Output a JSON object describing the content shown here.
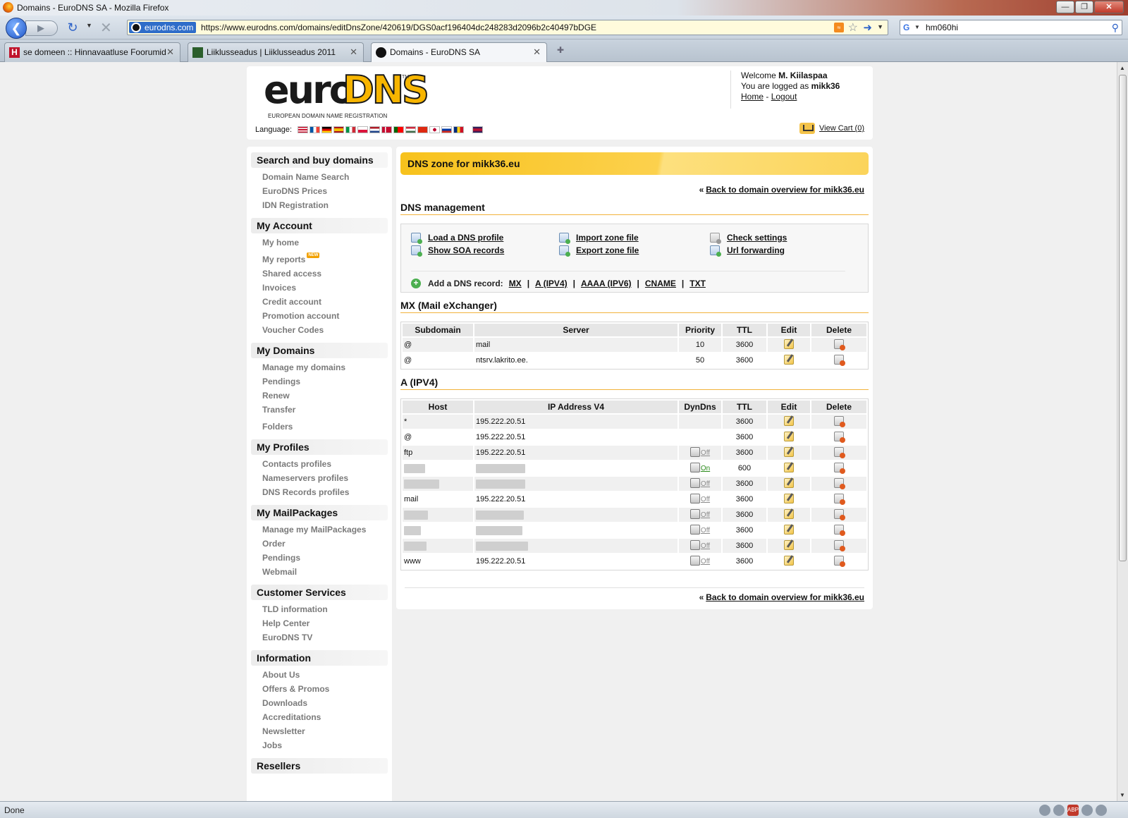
{
  "window": {
    "title": "Domains - EuroDNS SA - Mozilla Firefox"
  },
  "toolbar": {
    "site_identity": "eurodns.com",
    "url": "https://www.eurodns.com/domains/editDnsZone/420619/DGS0acf196404dc248283d2096b2c40497bDGE",
    "search_value": "hm060hi"
  },
  "tabs": [
    {
      "label": "se domeen :: Hinnavaatluse Foorumid"
    },
    {
      "label": "Liiklusseadus | Liiklusseadus 2011"
    },
    {
      "label": "Domains - EuroDNS SA"
    }
  ],
  "status": {
    "text": "Done"
  },
  "header": {
    "logo_euro": "euro",
    "logo_dns": "DNS",
    "tagline": "EUROPEAN DOMAIN NAME REGISTRATION",
    "welcome_prefix": "Welcome",
    "welcome_name": "M. Kiilaspaa",
    "logged_prefix": "You are logged as",
    "logged_user": "mikk36",
    "home_link": "Home",
    "separator": "-",
    "logout_link": "Logout",
    "language_label": "Language:",
    "cart_link": "View Cart (0)"
  },
  "sidebar": {
    "sections": [
      {
        "title": "Search and buy domains",
        "items": [
          "Domain Name Search",
          "EuroDNS Prices",
          "IDN Registration"
        ]
      },
      {
        "title": "My Account",
        "items": [
          "My home",
          "My reports",
          "Shared access",
          "Invoices",
          "Credit account",
          "Promotion account",
          "Voucher Codes"
        ]
      },
      {
        "title": "My Domains",
        "items": [
          "Manage my domains",
          "Pendings",
          "Renew",
          "Transfer",
          "Folders"
        ]
      },
      {
        "title": "My Profiles",
        "items": [
          "Contacts profiles",
          "Nameservers profiles",
          "DNS Records profiles"
        ]
      },
      {
        "title": "My MailPackages",
        "items": [
          "Manage my MailPackages",
          "Order",
          "Pendings",
          "Webmail"
        ]
      },
      {
        "title": "Customer Services",
        "items": [
          "TLD information",
          "Help Center",
          "EuroDNS TV"
        ]
      },
      {
        "title": "Information",
        "items": [
          "About Us",
          "Offers & Promos",
          "Downloads",
          "Accreditations",
          "Newsletter",
          "Jobs"
        ]
      },
      {
        "title": "Resellers",
        "items": []
      }
    ]
  },
  "main": {
    "banner": "DNS zone for mikk36.eu",
    "back_link": "Back to domain overview for mikk36.eu",
    "dns_management_title": "DNS management",
    "actions": {
      "load_profile": "Load a DNS profile",
      "show_soa": "Show SOA records",
      "import_zone": "Import zone file",
      "export_zone": "Export zone file",
      "check_settings": "Check settings",
      "url_forwarding": "Url forwarding"
    },
    "add_record_label": "Add a DNS record:",
    "record_types": [
      "MX",
      "A (IPV4)",
      "AAAA (IPV6)",
      "CNAME",
      "TXT"
    ],
    "mx": {
      "title": "MX (Mail eXchanger)",
      "headers": [
        "Subdomain",
        "Server",
        "Priority",
        "TTL",
        "Edit",
        "Delete"
      ],
      "rows": [
        {
          "subdomain": "@",
          "server": "mail",
          "priority": "10",
          "ttl": "3600"
        },
        {
          "subdomain": "@",
          "server": "ntsrv.lakrito.ee.",
          "priority": "50",
          "ttl": "3600"
        }
      ]
    },
    "a": {
      "title": "A (IPV4)",
      "headers": [
        "Host",
        "IP Address V4",
        "DynDns",
        "TTL",
        "Edit",
        "Delete"
      ],
      "rows": [
        {
          "host": "*",
          "ip": "195.222.20.51",
          "dyn": "",
          "ttl": "3600"
        },
        {
          "host": "@",
          "ip": "195.222.20.51",
          "dyn": "",
          "ttl": "3600"
        },
        {
          "host": "ftp",
          "ip": "195.222.20.51",
          "dyn": "Off",
          "ttl": "3600"
        },
        {
          "host": "",
          "ip": "",
          "dyn": "On",
          "ttl": "600"
        },
        {
          "host": "",
          "ip": "",
          "dyn": "Off",
          "ttl": "3600"
        },
        {
          "host": "mail",
          "ip": "195.222.20.51",
          "dyn": "Off",
          "ttl": "3600"
        },
        {
          "host": "",
          "ip": "",
          "dyn": "Off",
          "ttl": "3600"
        },
        {
          "host": "",
          "ip": "",
          "dyn": "Off",
          "ttl": "3600"
        },
        {
          "host": "",
          "ip": "",
          "dyn": "Off",
          "ttl": "3600"
        },
        {
          "host": "www",
          "ip": "195.222.20.51",
          "dyn": "Off",
          "ttl": "3600"
        }
      ]
    }
  },
  "colors": {
    "accent_yellow": "#f7c21c",
    "section_rule": "#f2b33c",
    "dyn_on": "#2a8a1a"
  },
  "icons": {
    "edit": "pencil-note-icon",
    "delete": "server-delete-icon",
    "dyndns": "computer-network-icon"
  }
}
